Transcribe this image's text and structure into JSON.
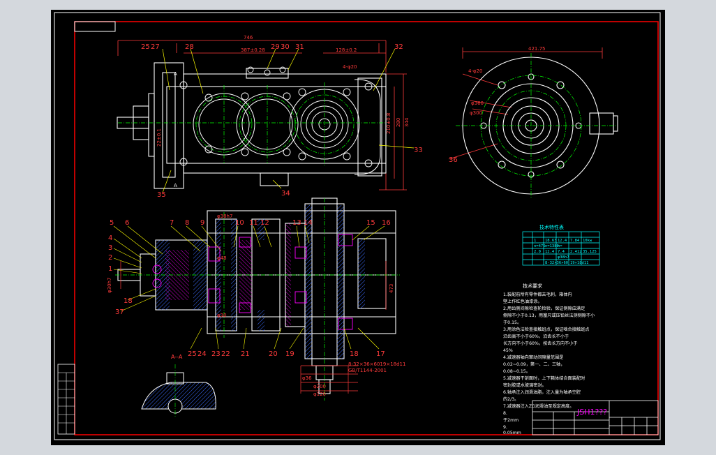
{
  "window": {
    "background": "#d4d8dd",
    "canvas": "#000000"
  },
  "colors": {
    "frame": "#ff0000",
    "part": "#ffffff",
    "dim": "#ff3b3b",
    "center": "#00ff00",
    "yellow": "#ffff00",
    "cyan": "#00ffff",
    "magenta": "#ff00ff",
    "hatch": "#3c6cff"
  },
  "title_block": {
    "drawing_title": "JSH1???"
  },
  "top_view": {
    "balloons": [
      "25",
      "27",
      "28",
      "29",
      "30",
      "31",
      "32",
      "33",
      "34",
      "35"
    ],
    "dims": [
      "746",
      "387±0.28",
      "128±0.2",
      "4-φ20",
      "210±0.8",
      "280",
      "344",
      "22±0.1"
    ],
    "section_marks": [
      "A",
      "A"
    ]
  },
  "side_view": {
    "balloons": [
      "36"
    ],
    "dims": [
      "421.75",
      "4-φ20",
      "φ360",
      "φ300"
    ]
  },
  "section_view": {
    "balloons": [
      "5",
      "6",
      "7",
      "8",
      "9",
      "10",
      "11",
      "12",
      "13",
      "14",
      "15",
      "16",
      "4",
      "3",
      "2",
      "1",
      "18",
      "37",
      "25",
      "24",
      "23",
      "22",
      "21",
      "20",
      "19",
      "18",
      "17"
    ],
    "dims": [
      "φ38h7",
      "φ48",
      "φ30",
      "φ36",
      "φ200",
      "φ120",
      "473",
      "8-32×36×6019×18d11",
      "GB/T1144-2001",
      "φ30h7",
      "φ16h7"
    ],
    "detail_label": "A--A"
  },
  "spec_table": {
    "title": "技术特性表",
    "rows": [
      [
        "",
        "",
        "",
        "",
        "",
        ""
      ],
      [
        "",
        "1",
        "18.63",
        "12.4",
        "7.84",
        "10kw"
      ],
      [
        "",
        "n=475",
        "n=1380",
        "n=",
        ""
      ],
      [
        "",
        "2.0",
        "12.4",
        "7.4",
        "2.412",
        "35.125"
      ],
      [
        "",
        "",
        "",
        "φ38h7",
        "",
        ""
      ],
      [
        "",
        "",
        "8-32×36×60",
        "19×18d11",
        "",
        ""
      ]
    ]
  },
  "tech_requirements": {
    "title": "技术要求",
    "lines": [
      "1.装配前所有零件都去毛刺，箱体内",
      "壁上作红色油漆涂。",
      "2.用齿侧间隙检查轮检验，保证侧隙应满足",
      "侧隙不小于0.13，用塞尺或压铅丝法测侧隙不小",
      "于0.15。",
      "3.用涂色法检查接触斑点，保证啮合接触斑点",
      "沿齿高不小于60%，沿齿长不小于",
      "长方向不小于60%，按齿长方向不小于",
      "45%",
      "4.减速器轴向窜动间隙量范围是",
      "0.02~0.09，第一、二、三轴，",
      "0.08~0.15。",
      "5.减速器干剖面时，上下箱体结合面装配时",
      "密封胶或水玻璃密封。",
      "6.轴承注入润滑油脂，注入量为轴承空腔",
      "的2/3。",
      "7.减速器注入ZG润滑油至规定高度。",
      "8.",
      "于2mm",
      "9.",
      "0.05mm"
    ]
  }
}
